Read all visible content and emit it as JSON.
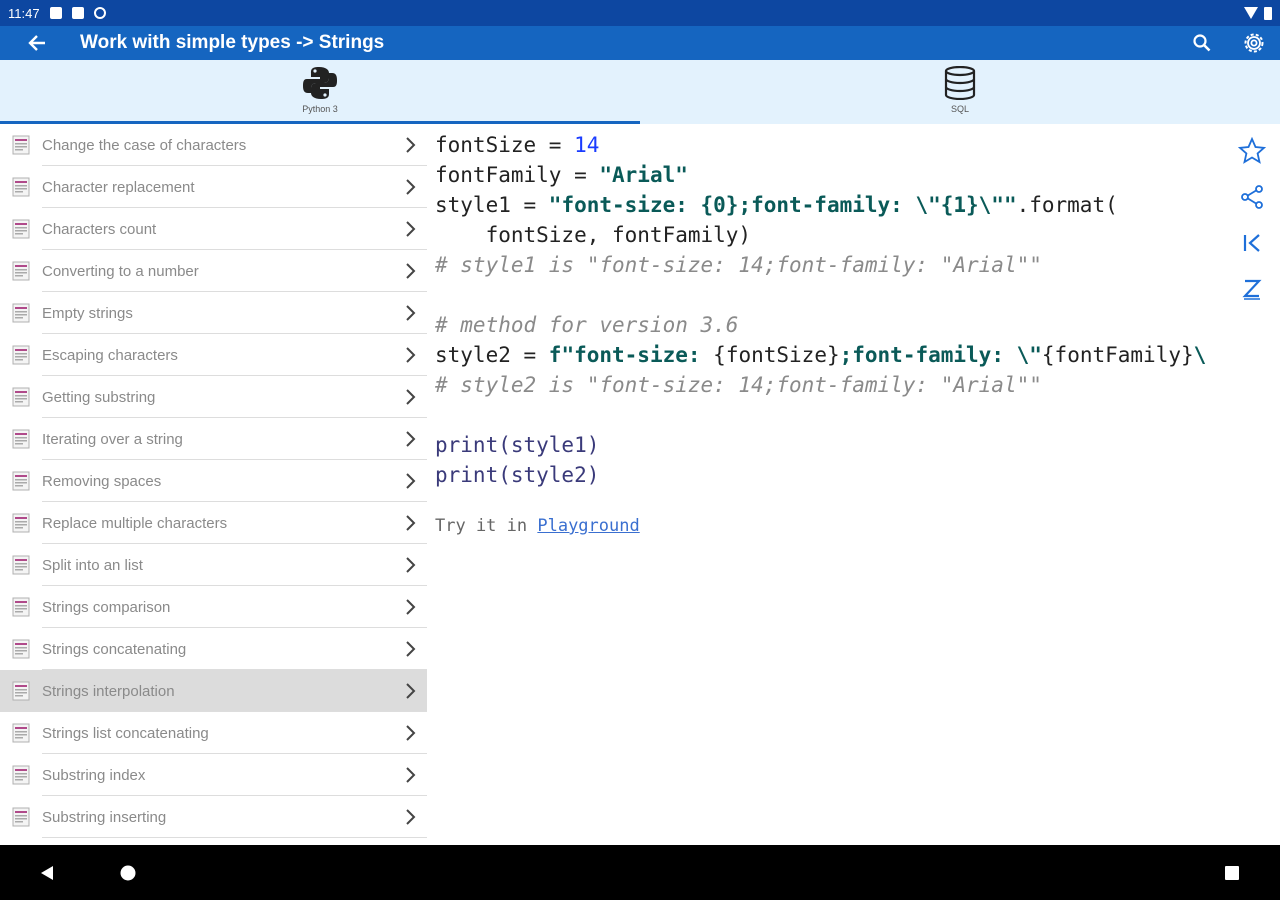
{
  "status": {
    "time": "11:47"
  },
  "appbar": {
    "title": "Work with simple types -> Strings"
  },
  "tabs": [
    {
      "label": "Python 3",
      "icon": "python-logo-icon",
      "active": true
    },
    {
      "label": "SQL",
      "icon": "database-icon",
      "active": false
    }
  ],
  "sidebar": {
    "items": [
      {
        "label": "Change the case of characters"
      },
      {
        "label": "Character replacement"
      },
      {
        "label": "Characters count"
      },
      {
        "label": "Converting to a number"
      },
      {
        "label": "Empty strings"
      },
      {
        "label": "Escaping characters"
      },
      {
        "label": "Getting substring"
      },
      {
        "label": "Iterating over a string"
      },
      {
        "label": "Removing spaces"
      },
      {
        "label": "Replace multiple characters"
      },
      {
        "label": "Split into an list"
      },
      {
        "label": "Strings comparison"
      },
      {
        "label": "Strings concatenating"
      },
      {
        "label": "Strings interpolation",
        "selected": true
      },
      {
        "label": "Strings list concatenating"
      },
      {
        "label": "Substring index"
      },
      {
        "label": "Substring inserting"
      }
    ]
  },
  "code": {
    "l1a": "fontSize = ",
    "l1b": "14",
    "l2a": "fontFamily = ",
    "l2b": "\"Arial\"",
    "l3a": "style1 = ",
    "l3b": "\"font-size: {0};font-family: \\\"{1}\\\"\"",
    "l3c": ".format(",
    "l4": "    fontSize, fontFamily)",
    "l5": "# style1 is \"font-size: 14;font-family: \"Arial\"\"",
    "l7": "# method for version 3.6",
    "l8a": "style2 = ",
    "l8b": "f\"font-size: ",
    "l8c": "{fontSize}",
    "l8d": ";font-family: \\\"",
    "l8e": "{fontFamily}",
    "l8f": "\\",
    "l9": "# style2 is \"font-size: 14;font-family: \"Arial\"\"",
    "l11": "print(style1)",
    "l12": "print(style2)"
  },
  "try": {
    "prefix": "Try it in ",
    "link": "Playground"
  },
  "colors": {
    "status_bar": "#0d47a1",
    "app_bar": "#1565c0",
    "tab_bg": "#e3f2fd",
    "string": "#0a5a58",
    "number": "#1a3cff",
    "comment": "#8a8a8a",
    "link": "#3a6fd0"
  }
}
